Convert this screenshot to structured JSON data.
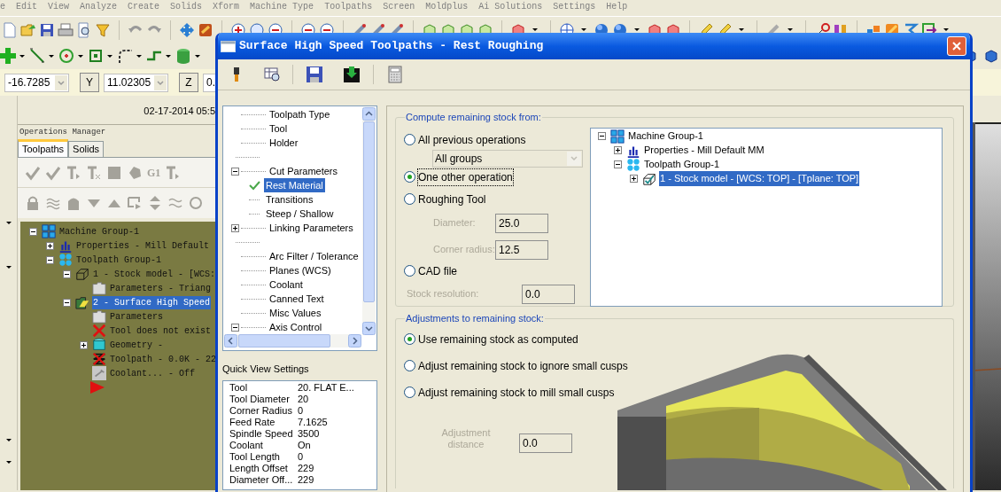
{
  "menu_bar": {
    "items": [
      "e",
      "Edit",
      "View",
      "Analyze",
      "Create",
      "Solids",
      "Xform",
      "Machine Type",
      "Toolpaths",
      "Screen",
      "Moldplus",
      "Ai Solutions",
      "Settings",
      "Help"
    ]
  },
  "coordinates": [
    {
      "value": "-16.7285"
    },
    {
      "axis": "Y",
      "value": "11.02305"
    },
    {
      "axis": "Z",
      "value": "0."
    }
  ],
  "timestamp": "02-17-2014 05:5",
  "operations_manager": {
    "title": "Operations Manager",
    "tabs": [
      {
        "label": "Toolpaths",
        "selected": true
      },
      {
        "label": "Solids",
        "selected": false
      }
    ],
    "toolbar_text": "G1",
    "tree": [
      {
        "label": "Machine Group-1",
        "kind": "machine_group",
        "expanded": true,
        "selected": false,
        "children": [
          {
            "label": "Properties - Mill Default",
            "kind": "properties",
            "expanded": false,
            "selected": false
          },
          {
            "label": "Toolpath Group-1",
            "kind": "toolpath_group",
            "expanded": true,
            "selected": false,
            "children": [
              {
                "label": "1 - Stock model - [WCS:",
                "kind": "stock",
                "expanded": true,
                "selected": false,
                "children": [
                  {
                    "label": "Parameters - Triang",
                    "kind": "folder",
                    "selected": false
                  }
                ]
              },
              {
                "label": "2 - Surface High Speed",
                "kind": "operation",
                "expanded": true,
                "selected": true,
                "children": [
                  {
                    "label": "Parameters",
                    "kind": "folder",
                    "selected": false
                  },
                  {
                    "label": "Tool does not exist",
                    "kind": "error",
                    "selected": false
                  },
                  {
                    "label": "Geometry -",
                    "kind": "geometry",
                    "expanded": false,
                    "selected": false
                  },
                  {
                    "label": "Toolpath - 0.0K - 22",
                    "kind": "toolpath",
                    "selected": false
                  },
                  {
                    "label": "Coolant... - Off",
                    "kind": "coolant",
                    "selected": false
                  }
                ]
              }
            ]
          }
        ]
      }
    ]
  },
  "dialog": {
    "title": "Surface High Speed Toolpaths - Rest Roughing",
    "nav_tree": [
      {
        "label": "Toolpath Type",
        "selected": false
      },
      {
        "label": "Tool",
        "selected": false
      },
      {
        "label": "Holder",
        "selected": false
      },
      {
        "label": "Cut Parameters",
        "selected": false,
        "gap_before": true,
        "expanded": true,
        "children": [
          {
            "label": "Rest Material",
            "selected": true
          },
          {
            "label": "Transitions",
            "selected": false
          },
          {
            "label": "Steep / Shallow",
            "selected": false
          }
        ]
      },
      {
        "label": "Linking Parameters",
        "selected": false,
        "expanded": false
      },
      {
        "label": "Arc Filter / Tolerance",
        "selected": false,
        "gap_before": true
      },
      {
        "label": "Planes (WCS)",
        "selected": false
      },
      {
        "label": "Coolant",
        "selected": false
      },
      {
        "label": "Canned Text",
        "selected": false
      },
      {
        "label": "Misc Values",
        "selected": false
      },
      {
        "label": "Axis Control",
        "selected": false,
        "expanded": true
      }
    ],
    "quick_view": {
      "title": "Quick View Settings",
      "rows": [
        {
          "name": "Tool",
          "value": "20. FLAT E..."
        },
        {
          "name": "Tool Diameter",
          "value": "20"
        },
        {
          "name": "Corner Radius",
          "value": "0"
        },
        {
          "name": "Feed Rate",
          "value": "7.1625"
        },
        {
          "name": "Spindle Speed",
          "value": "3500"
        },
        {
          "name": "Coolant",
          "value": "On"
        },
        {
          "name": "Tool Length",
          "value": "0"
        },
        {
          "name": "Length Offset",
          "value": "229"
        },
        {
          "name": "Diameter Off...",
          "value": "229"
        }
      ]
    },
    "compute": {
      "title": "Compute remaining stock from:",
      "options": [
        {
          "label": "All previous operations",
          "selected": false,
          "focused": false
        },
        {
          "label": "One other operation",
          "selected": true,
          "focused": true
        },
        {
          "label": "Roughing Tool",
          "selected": false,
          "focused": false
        },
        {
          "label": "CAD file",
          "selected": false,
          "focused": false
        }
      ],
      "group_select": {
        "value": "All groups",
        "disabled": true
      },
      "diameter": {
        "label": "Diameter:",
        "value": "25.0",
        "disabled": true
      },
      "corner_radius": {
        "label": "Corner radius:",
        "value": "12.5",
        "disabled": true
      },
      "stock_resolution": {
        "label": "Stock resolution:",
        "value": "0.0",
        "disabled": true
      },
      "operation_tree": [
        {
          "label": "Machine Group-1",
          "kind": "machine_group",
          "expanded": true,
          "selected": false,
          "children": [
            {
              "label": "Properties - Mill Default MM",
              "kind": "properties",
              "expanded": false,
              "selected": false
            },
            {
              "label": "Toolpath Group-1",
              "kind": "toolpath_group",
              "expanded": true,
              "selected": false,
              "children": [
                {
                  "label": "1 - Stock model - [WCS: TOP] - [Tplane: TOP]",
                  "kind": "stock_checked",
                  "expanded": false,
                  "selected": true
                }
              ]
            }
          ]
        }
      ]
    },
    "adjustments": {
      "title": "Adjustments to remaining stock:",
      "options": [
        {
          "label": "Use remaining stock as computed",
          "selected": true
        },
        {
          "label": "Adjust remaining stock to ignore small cusps",
          "selected": false
        },
        {
          "label": "Adjust remaining stock to mill small cusps",
          "selected": false
        }
      ],
      "adjustment_distance": {
        "label": "Adjustment distance",
        "value": "0.0",
        "disabled": true
      }
    }
  }
}
